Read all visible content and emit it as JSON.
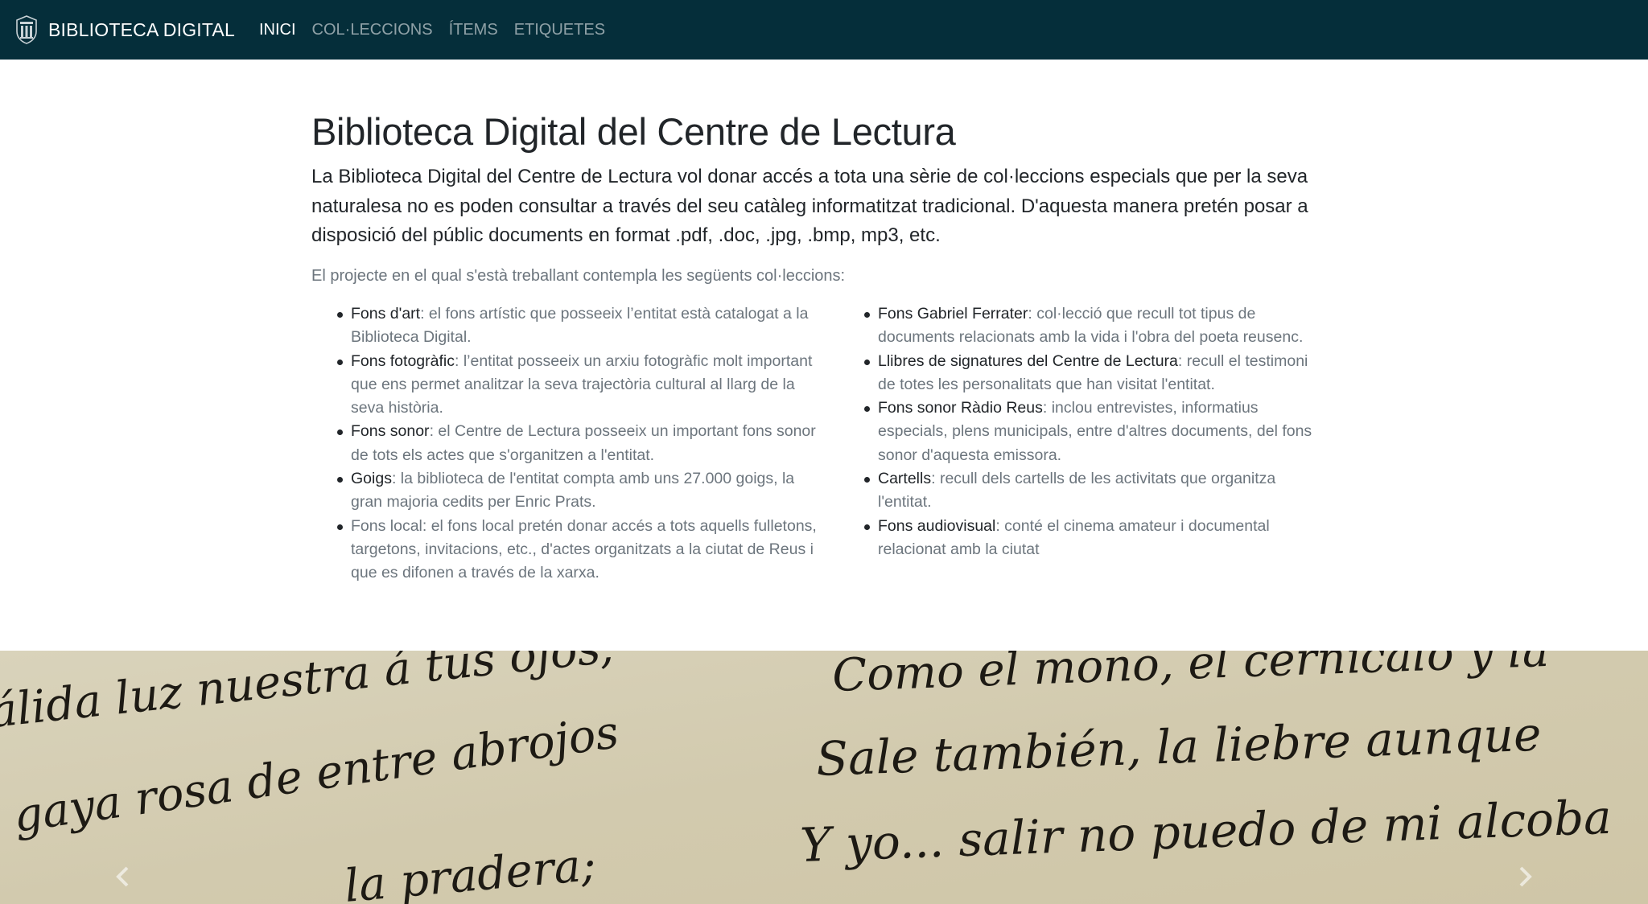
{
  "navbar": {
    "brand": "BIBLIOTECA DIGITAL",
    "links": [
      {
        "label": "INICI",
        "active": true
      },
      {
        "label": "COL·LECCIONS",
        "active": false
      },
      {
        "label": "ÍTEMS",
        "active": false
      },
      {
        "label": "ETIQUETES",
        "active": false
      }
    ]
  },
  "main": {
    "title": "Biblioteca Digital del Centre de Lectura",
    "lead": "La Biblioteca Digital del Centre de Lectura vol donar accés a tota una sèrie de col·leccions especials que per la seva naturalesa no es poden consultar a través del seu catàleg informatitzat tradicional. D'aquesta manera pretén posar a disposició del públic documents en format .pdf, .doc, .jpg, .bmp, mp3, etc.",
    "intro": "El projecte en el qual s'està treballant contempla les següents col·leccions:",
    "left_list": [
      {
        "term": "Fons d'art",
        "desc": ": el fons artístic que posseeix l’entitat està catalogat a la Biblioteca Digital."
      },
      {
        "term": "Fons fotogràfic",
        "desc": ": l’entitat posseeix un arxiu fotogràfic molt important que ens permet analitzar la seva trajectòria cultural al llarg de la seva història."
      },
      {
        "term": "Fons sonor",
        "desc": ": el Centre de Lectura posseeix un important fons sonor de tots els actes que s'organitzen a l'entitat."
      },
      {
        "term": "Goigs",
        "desc": ": la biblioteca de l'entitat compta amb uns 27.000 goigs, la gran majoria cedits per Enric Prats."
      },
      {
        "term": "",
        "desc": "Fons local: el fons local pretén donar accés a tots aquells fulletons, targetons, invitacions, etc., d'actes organitzats a la ciutat de Reus i que es difonen a través de la xarxa."
      }
    ],
    "right_list": [
      {
        "term": "Fons Gabriel Ferrater",
        "desc": ": col·lecció que recull tot tipus de documents relacionats amb la vida i l'obra del poeta reusenc."
      },
      {
        "term": "Llibres de signatures del Centre de Lectura",
        "desc": ": recull el testimoni de totes les personalitats que han visitat l'entitat."
      },
      {
        "term": "Fons sonor Ràdio Reus",
        "desc": ": inclou entrevistes, informatius especials, plens municipals, entre d'altres documents, del fons sonor d'aquesta emissora."
      },
      {
        "term": "Cartells",
        "desc": ": recull dels cartells de les activitats que organitza l'entitat."
      },
      {
        "term": "Fons audiovisual",
        "desc": ": conté el cinema amateur i documental relacionat amb la ciutat"
      }
    ]
  },
  "carousel": {
    "manuscript_lines": [
      "álida luz nuestra á tus ojos;",
      "Como el mono, el cernícalo y la",
      "gaya rosa de entre abrojos",
      "Sale también, la liebre aunque",
      "la pradera;",
      "Y yo... salir no puedo de mi alcoba"
    ],
    "icons": {
      "prev": "chevron-left-icon",
      "next": "chevron-right-icon"
    }
  },
  "colors": {
    "navbar_bg": "#052e3a",
    "text": "#212529",
    "muted": "#6c757d",
    "paper": "#d7d0b6"
  }
}
